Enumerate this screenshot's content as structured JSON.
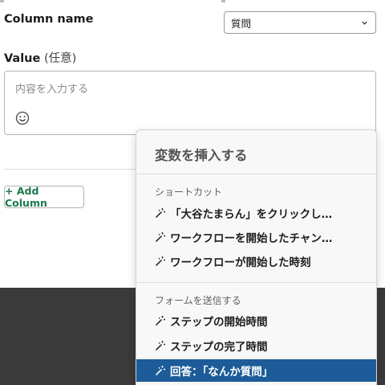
{
  "column": {
    "label": "Column name",
    "selected": "質問"
  },
  "value": {
    "label": "Value",
    "optional": "(任意)",
    "placeholder": "内容を入力する"
  },
  "add_column": {
    "label": "+ Add Column"
  },
  "insert_menu": {
    "title": "変数を挿入する",
    "sections": [
      {
        "heading": "ショートカット",
        "items": [
          "「大谷たまらん」をクリックし…",
          "ワークフローを開始したチャン…",
          "ワークフローが開始した時刻"
        ]
      },
      {
        "heading": "フォームを送信する",
        "items": [
          "ステップの開始時間",
          "ステップの完了時間",
          "回答：「なんか質問」"
        ]
      }
    ]
  },
  "colors": {
    "selected_item_bg": "#1d5c99",
    "add_column_text": "#1a7a4c",
    "backdrop": "#3a3a3a"
  },
  "icons": {
    "select_chevron": "chevron-down-icon",
    "emoji_picker": "smiley-icon",
    "variable_items": "magic-wand-icon"
  }
}
